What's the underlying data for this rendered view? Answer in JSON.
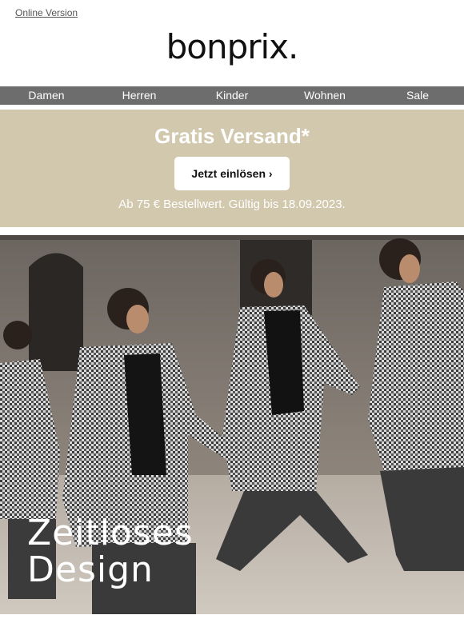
{
  "header": {
    "online_version": "Online Version",
    "logo": "bonprix."
  },
  "nav": {
    "items": [
      {
        "label": "Damen"
      },
      {
        "label": "Herren"
      },
      {
        "label": "Kinder"
      },
      {
        "label": "Wohnen"
      },
      {
        "label": "Sale"
      }
    ]
  },
  "promo": {
    "title": "Gratis Versand*",
    "button_label": "Jetzt einlösen ›",
    "note": "Ab 75 € Bestellwert. Gültig bis 18.09.2023."
  },
  "hero": {
    "line1": "Zeitloses",
    "line2": "Design"
  },
  "colors": {
    "nav_bg": "#6d6d6d",
    "promo_bg": "#d1c8ad"
  }
}
